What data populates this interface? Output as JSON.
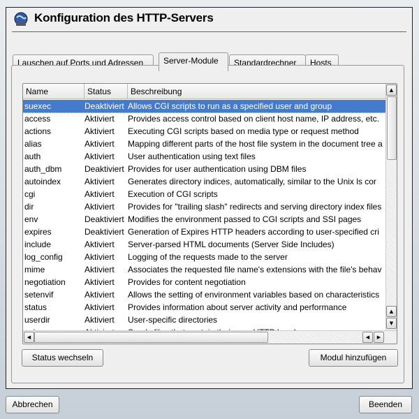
{
  "dialog": {
    "title": "Konfiguration des HTTP-Servers",
    "logo": "http-globe-icon"
  },
  "tabs": [
    {
      "label": "Lauschen auf Ports und Adressen",
      "active": false
    },
    {
      "label": "Server-Module",
      "active": true
    },
    {
      "label": "Standardrechner",
      "active": false
    },
    {
      "label": "Hosts",
      "active": false
    }
  ],
  "table": {
    "columns": [
      "Name",
      "Status",
      "Beschreibung"
    ],
    "selected_row": 0,
    "rows": [
      [
        "suexec",
        "Deaktiviert",
        "Allows CGI scripts to run as a specified user and group"
      ],
      [
        "access",
        "Aktiviert",
        "Provides access control based on client host name, IP address, etc."
      ],
      [
        "actions",
        "Aktiviert",
        "Executing CGI scripts based on media type or request method"
      ],
      [
        "alias",
        "Aktiviert",
        "Mapping different parts of the host file system in the document tree a"
      ],
      [
        "auth",
        "Aktiviert",
        "User authentication using text files"
      ],
      [
        "auth_dbm",
        "Deaktiviert",
        "Provides for user authentication using DBM files"
      ],
      [
        "autoindex",
        "Aktiviert",
        "Generates directory indices, automatically, similar to the Unix ls cor"
      ],
      [
        "cgi",
        "Aktiviert",
        "Execution of CGI scripts"
      ],
      [
        "dir",
        "Aktiviert",
        "Provides for \"trailing slash\" redirects and serving directory index files"
      ],
      [
        "env",
        "Deaktiviert",
        "Modifies the environment passed to CGI scripts and SSI pages"
      ],
      [
        "expires",
        "Deaktiviert",
        "Generation of Expires HTTP headers according to user-specified cri"
      ],
      [
        "include",
        "Aktiviert",
        "Server-parsed HTML documents (Server Side Includes)"
      ],
      [
        "log_config",
        "Aktiviert",
        "Logging of the requests made to the server"
      ],
      [
        "mime",
        "Aktiviert",
        "Associates the requested file name's extensions with the file's behav"
      ],
      [
        "negotiation",
        "Aktiviert",
        "Provides for content negotiation"
      ],
      [
        "setenvif",
        "Aktiviert",
        "Allows the setting of environment variables based on characteristics"
      ],
      [
        "status",
        "Aktiviert",
        "Provides information about server activity and performance"
      ],
      [
        "userdir",
        "Aktiviert",
        "User-specific directories"
      ],
      [
        "asis",
        "Aktiviert",
        "Sends files that contain their own HTTP headers"
      ]
    ]
  },
  "buttons": {
    "toggle_status": "Status wechseln",
    "add_module": "Modul hinzufügen",
    "cancel": "Abbrechen",
    "finish": "Beenden"
  },
  "icons": {
    "up": "▲",
    "down": "▼",
    "left": "◀",
    "right": "▶"
  },
  "colors": {
    "selection": "#447bcd"
  }
}
